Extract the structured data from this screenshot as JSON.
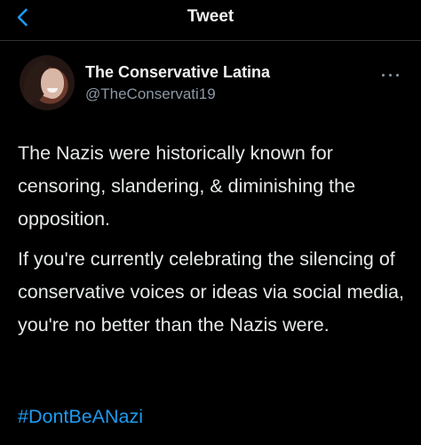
{
  "header": {
    "title": "Tweet",
    "back_icon": "chevron-left-icon",
    "accent": "#1d9bf0"
  },
  "tweet": {
    "author": {
      "display_name": "The Conservative Latina",
      "handle": "@TheConservati19",
      "avatar_icon": "avatar-photo"
    },
    "more_icon": "more-horizontal-icon",
    "paragraphs": [
      "The Nazis were historically known for censoring, slandering, & diminishing the opposition.",
      "If you're currently celebrating the silencing of conservative voices or ideas via social media, you're no better than the Nazis were."
    ],
    "hashtag": "#DontBeANazi"
  },
  "colors": {
    "background": "#000000",
    "text": "#e7e9ea",
    "secondary_text": "#8b98a5",
    "link": "#1d9bf0",
    "divider": "#2f3336"
  }
}
